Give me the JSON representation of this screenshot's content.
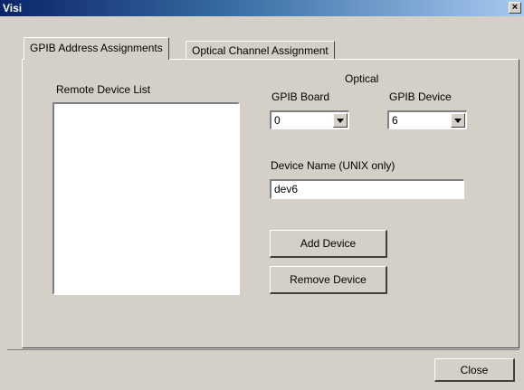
{
  "window": {
    "title": "Visi",
    "close_glyph": "×"
  },
  "tabs": [
    {
      "label": "GPIB Address Assignments",
      "active": true
    },
    {
      "label": "Optical Channel Assignment",
      "active": false
    }
  ],
  "remote_device_list": {
    "label": "Remote Device List",
    "items": []
  },
  "optical": {
    "heading": "Optical",
    "gpib_board": {
      "label": "GPIB Board",
      "value": "0"
    },
    "gpib_device": {
      "label": "GPIB Device",
      "value": "6"
    }
  },
  "device_name": {
    "label": "Device Name (UNIX only)",
    "value": "dev6"
  },
  "buttons": {
    "add": "Add Device",
    "remove": "Remove Device",
    "close": "Close"
  }
}
